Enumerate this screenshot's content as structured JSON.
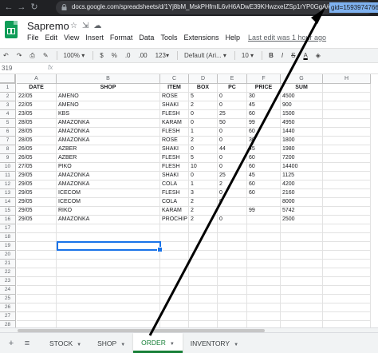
{
  "browser": {
    "url": "docs.google.com/spreadsheets/d/1Yj8bM_MskPHfmIL6vH6ADwE39KHwzxeIZSp1rYP0GgA/edit#",
    "url_highlight": "gid=1593974766",
    "nav_icons": [
      "back-icon",
      "forward-icon",
      "reload-icon"
    ],
    "highlight_color": "#7fb2f0"
  },
  "app": {
    "title": "Sapremo",
    "title_icons": [
      "star-icon",
      "move-icon",
      "cloud-status-icon"
    ],
    "menu": [
      "File",
      "Edit",
      "View",
      "Insert",
      "Format",
      "Data",
      "Tools",
      "Extensions",
      "Help"
    ],
    "last_edit": "Last edit was 1 hour ago",
    "brand_color": "#0f9d58"
  },
  "toolbar": {
    "zoom": "100%",
    "currency": "$",
    "percent": "%",
    "decimal_less": ".0",
    "decimal_more": ".00",
    "number_format": "123",
    "font": "Default (Ari...",
    "font_size": "10",
    "bold": "B",
    "italic": "I",
    "strike": "S",
    "text_color": "A"
  },
  "formula_bar": {
    "name_box": "319",
    "fx": "fx",
    "value": ""
  },
  "grid": {
    "columns": [
      "A",
      "B",
      "C",
      "D",
      "E",
      "F",
      "G",
      "H"
    ],
    "header_row": [
      "DATE",
      "SHOP",
      "ITEM",
      "BOX",
      "PC",
      "PRICE",
      "SUM",
      ""
    ],
    "rows": [
      [
        "22/05",
        "AMENO",
        "ROSE",
        "5",
        "0",
        "30",
        "4500",
        ""
      ],
      [
        "22/05",
        "AMENO",
        "SHAKI",
        "2",
        "0",
        "45",
        "900",
        ""
      ],
      [
        "23/05",
        "KBS",
        "FLESH",
        "0",
        "25",
        "60",
        "1500",
        ""
      ],
      [
        "28/05",
        "AMAZONKA",
        "KARAM",
        "0",
        "50",
        "99",
        "4950",
        ""
      ],
      [
        "28/05",
        "AMAZONKA",
        "FLESH",
        "1",
        "0",
        "60",
        "1440",
        ""
      ],
      [
        "28/05",
        "AMAZONKA",
        "ROSE",
        "2",
        "0",
        "30",
        "1800",
        ""
      ],
      [
        "26/05",
        "AZBER",
        "SHAKI",
        "0",
        "44",
        "45",
        "1980",
        ""
      ],
      [
        "26/05",
        "AZBER",
        "FLESH",
        "5",
        "0",
        "60",
        "7200",
        ""
      ],
      [
        "27/05",
        "PIKO",
        "FLESH",
        "10",
        "0",
        "60",
        "14400",
        ""
      ],
      [
        "29/05",
        "AMAZONKA",
        "SHAKI",
        "0",
        "25",
        "45",
        "1125",
        ""
      ],
      [
        "29/05",
        "AMAZONKA",
        "COLA",
        "1",
        "2",
        "60",
        "4200",
        ""
      ],
      [
        "29/05",
        "ICECOM",
        "FLESH",
        "3",
        "0",
        "60",
        "2160",
        ""
      ],
      [
        "29/05",
        "ICECOM",
        "COLA",
        "2",
        "0",
        "",
        "8000",
        ""
      ],
      [
        "29/05",
        "RIKO",
        "KARAM",
        "2",
        "",
        "99",
        "5742",
        ""
      ],
      [
        "29/05",
        "AMAZONKA",
        "PROCHIP",
        "2",
        "0",
        "",
        "2500",
        ""
      ]
    ],
    "row_numbers": [
      "1",
      "2",
      "3",
      "4",
      "5",
      "6",
      "7",
      "8",
      "9",
      "10",
      "11",
      "12",
      "13",
      "14",
      "15",
      "16",
      "17",
      "18",
      "19",
      "20",
      "21",
      "22",
      "23",
      "24",
      "25",
      "26",
      "27",
      "28"
    ],
    "selected_cell": "B19",
    "selection_color": "#1a73e8"
  },
  "tabs": {
    "add_icon": "plus-icon",
    "list_icon": "sheet-list-icon",
    "items": [
      {
        "label": "STOCK",
        "active": false
      },
      {
        "label": "SHOP",
        "active": false
      },
      {
        "label": "ORDER",
        "active": true
      },
      {
        "label": "INVENTORY",
        "active": false
      }
    ],
    "active_color": "#188038"
  },
  "annotation": {
    "type": "arrow",
    "color": "#000000",
    "from": "ORDER tab",
    "to": "gid in URL"
  }
}
